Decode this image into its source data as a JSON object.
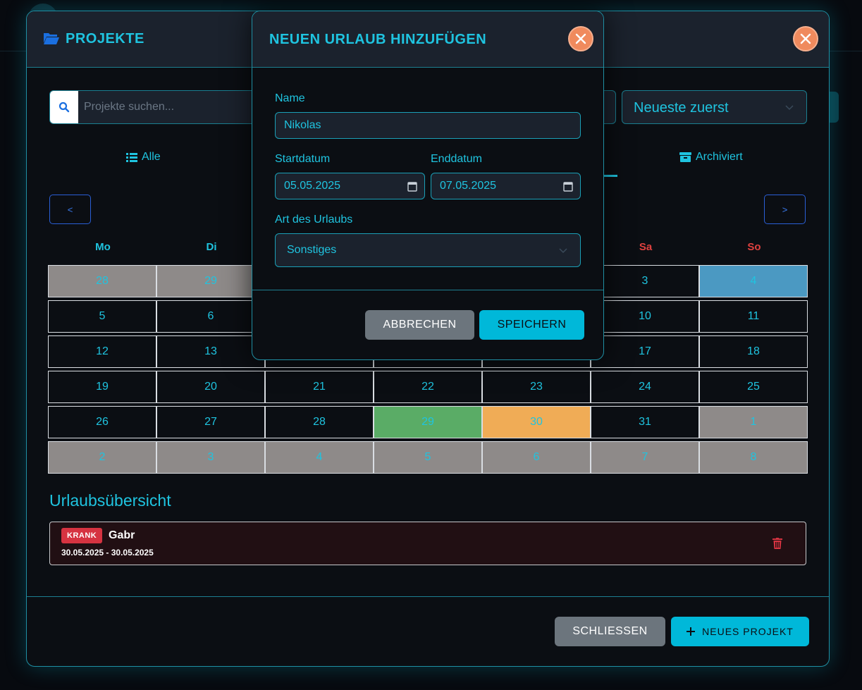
{
  "projects_modal": {
    "title": "PROJEKTE",
    "search_placeholder": "Projekte suchen...",
    "sort_selected": "Neueste zuerst",
    "tabs": [
      {
        "label": "Alle"
      },
      {
        "label": "Archiviert"
      }
    ],
    "nav_prev": "<",
    "nav_next": ">",
    "weekdays": [
      "Mo",
      "Di",
      "",
      "",
      "",
      "Sa",
      "So"
    ],
    "calendar_rows": [
      [
        "28",
        "29",
        "",
        "",
        "",
        "3",
        "4"
      ],
      [
        "5",
        "6",
        "",
        "",
        "",
        "10",
        "11"
      ],
      [
        "12",
        "13",
        "",
        "",
        "",
        "17",
        "18"
      ],
      [
        "19",
        "20",
        "21",
        "22",
        "23",
        "24",
        "25"
      ],
      [
        "26",
        "27",
        "28",
        "29",
        "30",
        "31",
        "1"
      ],
      [
        "2",
        "3",
        "4",
        "5",
        "6",
        "7",
        "8"
      ]
    ],
    "overview_title": "Urlaubsübersicht",
    "entries": [
      {
        "type": "KRANK",
        "name": "Gabr",
        "dates": "30.05.2025 - 30.05.2025"
      }
    ],
    "close_label": "SCHLIESSEN",
    "new_project_label": "NEUES PROJEKT"
  },
  "vacation_modal": {
    "title": "NEUEN URLAUB HINZUFÜGEN",
    "name_label": "Name",
    "name_value": "Nikolas",
    "start_label": "Startdatum",
    "start_value": "05.05.2025",
    "end_label": "Enddatum",
    "end_value": "07.05.2025",
    "type_label": "Art des Urlaubs",
    "type_value": "Sonstiges",
    "cancel_label": "ABBRECHEN",
    "save_label": "SPEICHERN"
  },
  "colors": {
    "accent": "#1fc4e0",
    "close_button": "#f08a5d",
    "weekend": "#e0413f",
    "badge_krank": "#d63341",
    "highlight_blue": "#4b99c2",
    "highlight_green": "#5aac66",
    "highlight_orange": "#f0ac56",
    "other_month": "#8e8a89"
  }
}
